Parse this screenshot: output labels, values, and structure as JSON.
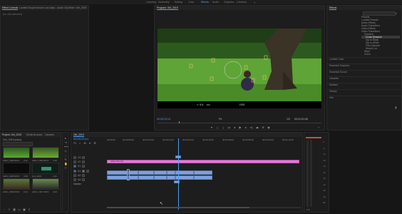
{
  "workspaces": [
    "Learning",
    "Assembly",
    "Editing",
    "Color",
    "Effects",
    "Audio",
    "Graphics",
    "Libraries"
  ],
  "left_top_tabs": [
    "Effect Controls",
    "Lumetri Scopes",
    "Source: (no clips)",
    "Audio Clip Mixer: Girl_2019"
  ],
  "left_top_empty": "(no clip selected)",
  "program": {
    "title": "Program: Girl_2019",
    "timecode_left": "00;00;23;14",
    "fit": "Fit",
    "quality": "1/2",
    "timecode_right": "00;01;01;06"
  },
  "hud": {
    "aperture": "5.6",
    "shutter": "400",
    "iso": "1592"
  },
  "effects": {
    "title": "Effects",
    "items": [
      "Presets",
      "Lumetri Presets",
      "Audio Effects",
      "Audio Transitions",
      "Video Effects",
      "Video Transitions",
      "Dissolve",
      "Cross Dissolve",
      "Dip to Black",
      "Dip to White",
      "Film Dissolve",
      "Morph Cut",
      "Wipe",
      "Zoom",
      "Lumetri Color",
      "Essential Graphics",
      "Essential Sound",
      "Libraries",
      "Markers",
      "History",
      "Info"
    ]
  },
  "project": {
    "title": "Project: Girl_2019",
    "tabs": [
      "Project: Girl_2019",
      "Media Browser",
      "Libraries"
    ],
    "clips": [
      "Girl_2019.prproj",
      "A001_C003.MOV",
      "A001_C004.MOV",
      "A001_C005.MOV",
      "A001_C006.MOV",
      "Girl_2019",
      "A001_C007.MOV"
    ],
    "durations": [
      "0:11",
      "0:12",
      "4:16",
      "0:09",
      "0:24",
      "1:01",
      "0:18"
    ]
  },
  "timeline": {
    "tab": "Girl_2019",
    "timecode": "00;00;23;14",
    "ruler": [
      "00;00;00",
      "00;00;08;00",
      "00;00;16;00",
      "00;00;24;00",
      "00;00;32;00",
      "00;00;40;00",
      "00;00;48;00",
      "00;00;56;00",
      "00;01;04;00",
      "00;01;12;00"
    ],
    "tracks": [
      "V3",
      "V2",
      "V1",
      "A1",
      "A2",
      "A3",
      "Master"
    ],
    "graphic_label": "Adobe Title Clip"
  },
  "meter": {
    "labels": [
      "0",
      "-6",
      "-12",
      "-18",
      "-24",
      "-30",
      "-36",
      "-42",
      "-48",
      "-54",
      "dB"
    ],
    "solo": "S S"
  }
}
